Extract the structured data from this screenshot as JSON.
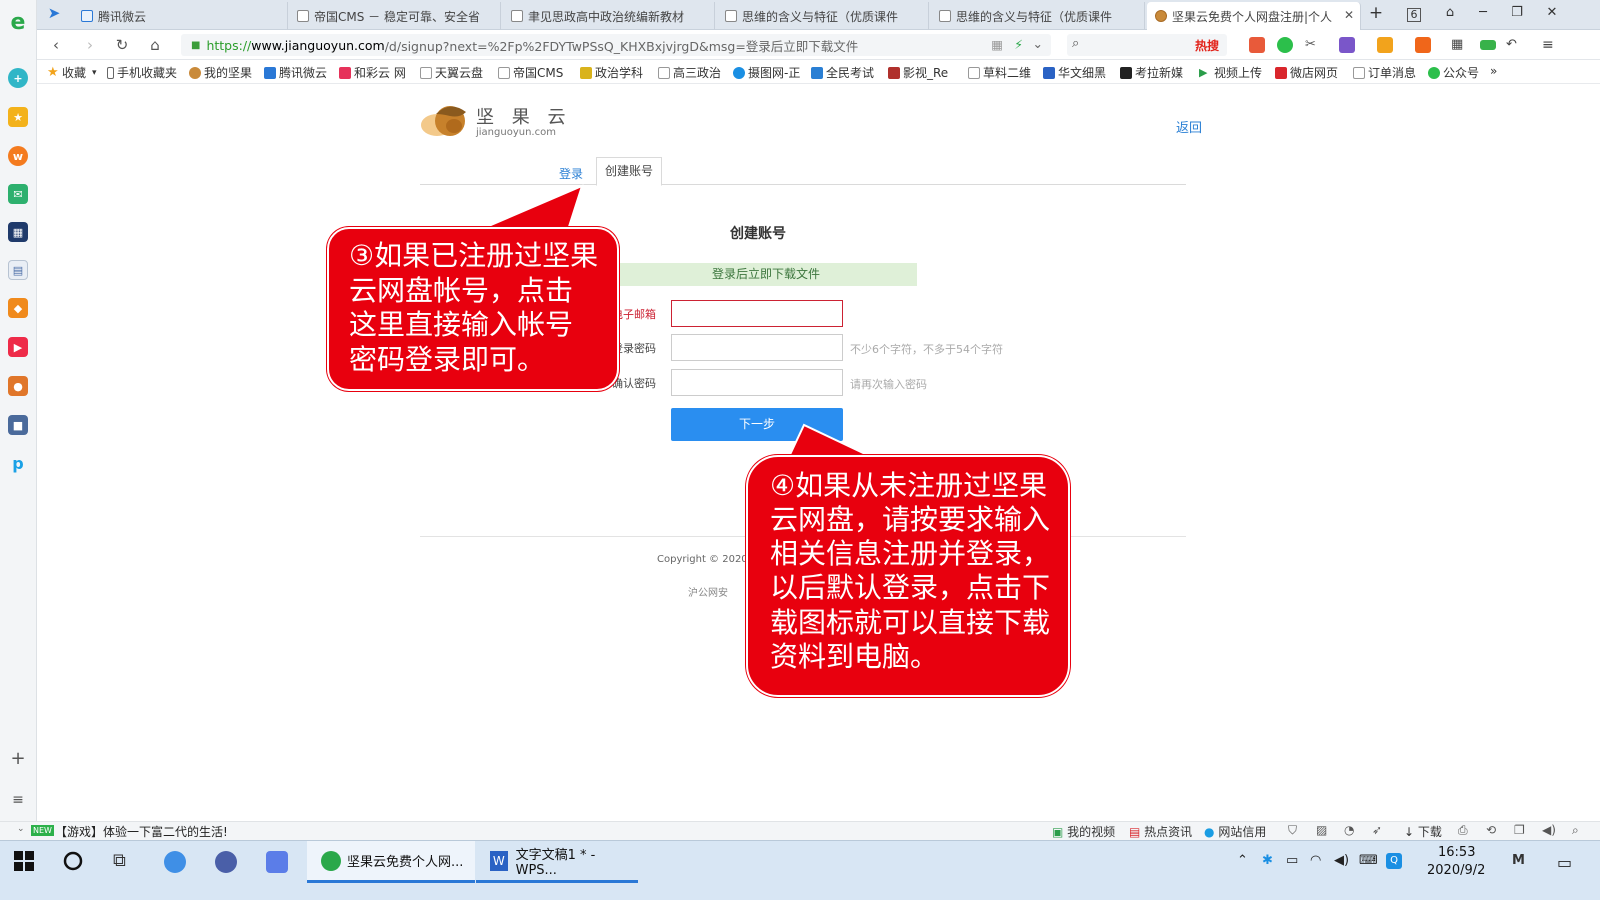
{
  "browser": {
    "tabs": [
      {
        "label": "腾讯微云",
        "active": false
      },
      {
        "label": "帝国CMS － 稳定可靠、安全省",
        "active": false
      },
      {
        "label": "聿见思政高中政治统编新教材",
        "active": false
      },
      {
        "label": "思维的含义与特征（优质课件",
        "active": false
      },
      {
        "label": "思维的含义与特征（优质课件",
        "active": false
      },
      {
        "label": "坚果云免费个人网盘注册|个人",
        "active": true
      }
    ],
    "tab_count": "6",
    "url_protocol": "https://",
    "url_host": "www.jianguoyun.com",
    "url_rest": "/d/signup?next=%2Fp%2FDYTwPSsQ_KHXBxjvjrgD&msg=登录后立即下载文件",
    "search_hot": "热搜",
    "bookmarks": [
      "收藏",
      "手机收藏夹",
      "我的坚果",
      "腾讯微云",
      "和彩云 网",
      "天翼云盘",
      "帝国CMS",
      "政治学科",
      "高三政治",
      "摄图网-正",
      "全民考试",
      "影视_Re",
      "草料二维",
      "华文细黑",
      "考拉新媒",
      "视频上传",
      "微店网页",
      "订单消息",
      "公众号",
      "»"
    ]
  },
  "page": {
    "logo_cn": "坚 果 云",
    "logo_en": "jianguoyun.com",
    "back_label": "返回",
    "tab_login": "登录",
    "tab_signup": "创建账号",
    "form_title": "创建账号",
    "notice": "登录后立即下载文件",
    "email_label": "电子邮箱",
    "password_label": "登录密码",
    "password_hint": "不少6个字符，不多于54个字符",
    "confirm_label": "确认密码",
    "confirm_hint": "请再次输入密码",
    "next_label": "下一步",
    "copyright": "Copyright © 2020",
    "icp": "沪公网安"
  },
  "callouts": {
    "login_tip": "③如果已注册过坚果云网盘帐号，点击这里直接输入帐号密码登录即可。",
    "signup_tip": "④如果从未注册过坚果云网盘，请按要求输入相关信息注册并登录，以后默认登录，点击下载图标就可以直接下载资料到电脑。"
  },
  "statusbar": {
    "news_badge": "NEW",
    "news": "【游戏】体验一下富二代的生活!",
    "items": [
      "我的视频",
      "热点资讯",
      "网站信用",
      "下载"
    ]
  },
  "taskbar": {
    "apps": [
      {
        "label": "坚果云免费个人网...",
        "active": true
      },
      {
        "label": "文字文稿1 * - WPS...",
        "active": false
      }
    ],
    "time": "16:53",
    "date": "2020/9/2"
  },
  "colors": {
    "callout_red": "#e8000e",
    "link_blue": "#2a7fd4",
    "button_blue": "#2a8ef0",
    "notice_bg": "#dff0d8"
  }
}
